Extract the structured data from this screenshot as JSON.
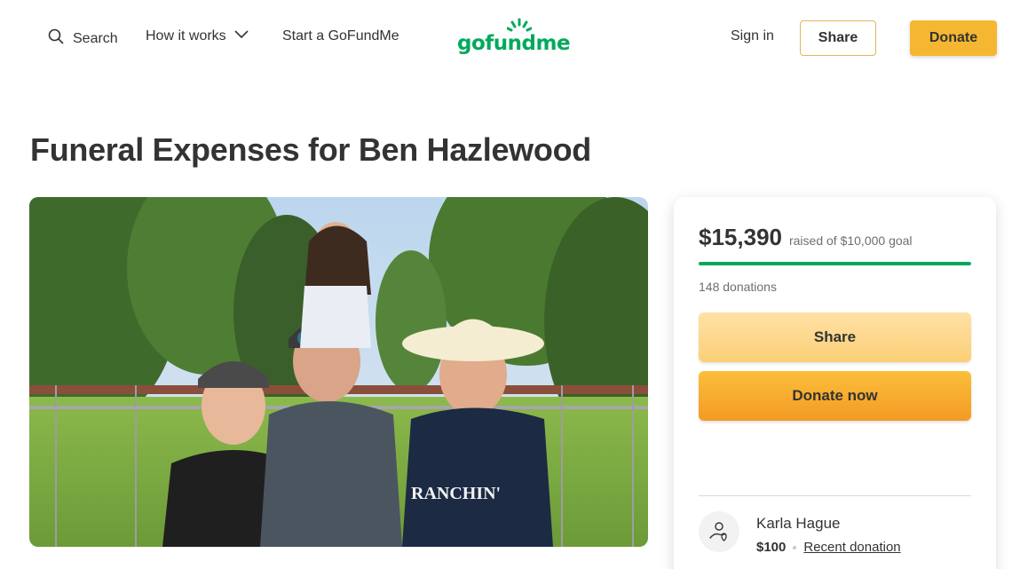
{
  "header": {
    "search_label": "Search",
    "how_it_works_label": "How it works",
    "start_label": "Start a GoFundMe",
    "logo_text": "gofundme",
    "signin_label": "Sign in",
    "share_label": "Share",
    "donate_label": "Donate"
  },
  "campaign": {
    "title": "Funeral Expenses for Ben Hazlewood",
    "raised_amount": "$15,390",
    "raised_goal_text": "raised of $10,000 goal",
    "progress_fraction": 1.0,
    "donations_count": "148 donations",
    "share_button": "Share",
    "donate_button": "Donate now",
    "recent_donor": {
      "name": "Karla Hague",
      "amount": "$100",
      "link_label": "Recent donation"
    }
  },
  "colors": {
    "brand_green": "#02a95c",
    "donate_orange": "#f5b731"
  },
  "icons": [
    "search-icon",
    "chevron-down-icon",
    "heart-hand-icon"
  ]
}
